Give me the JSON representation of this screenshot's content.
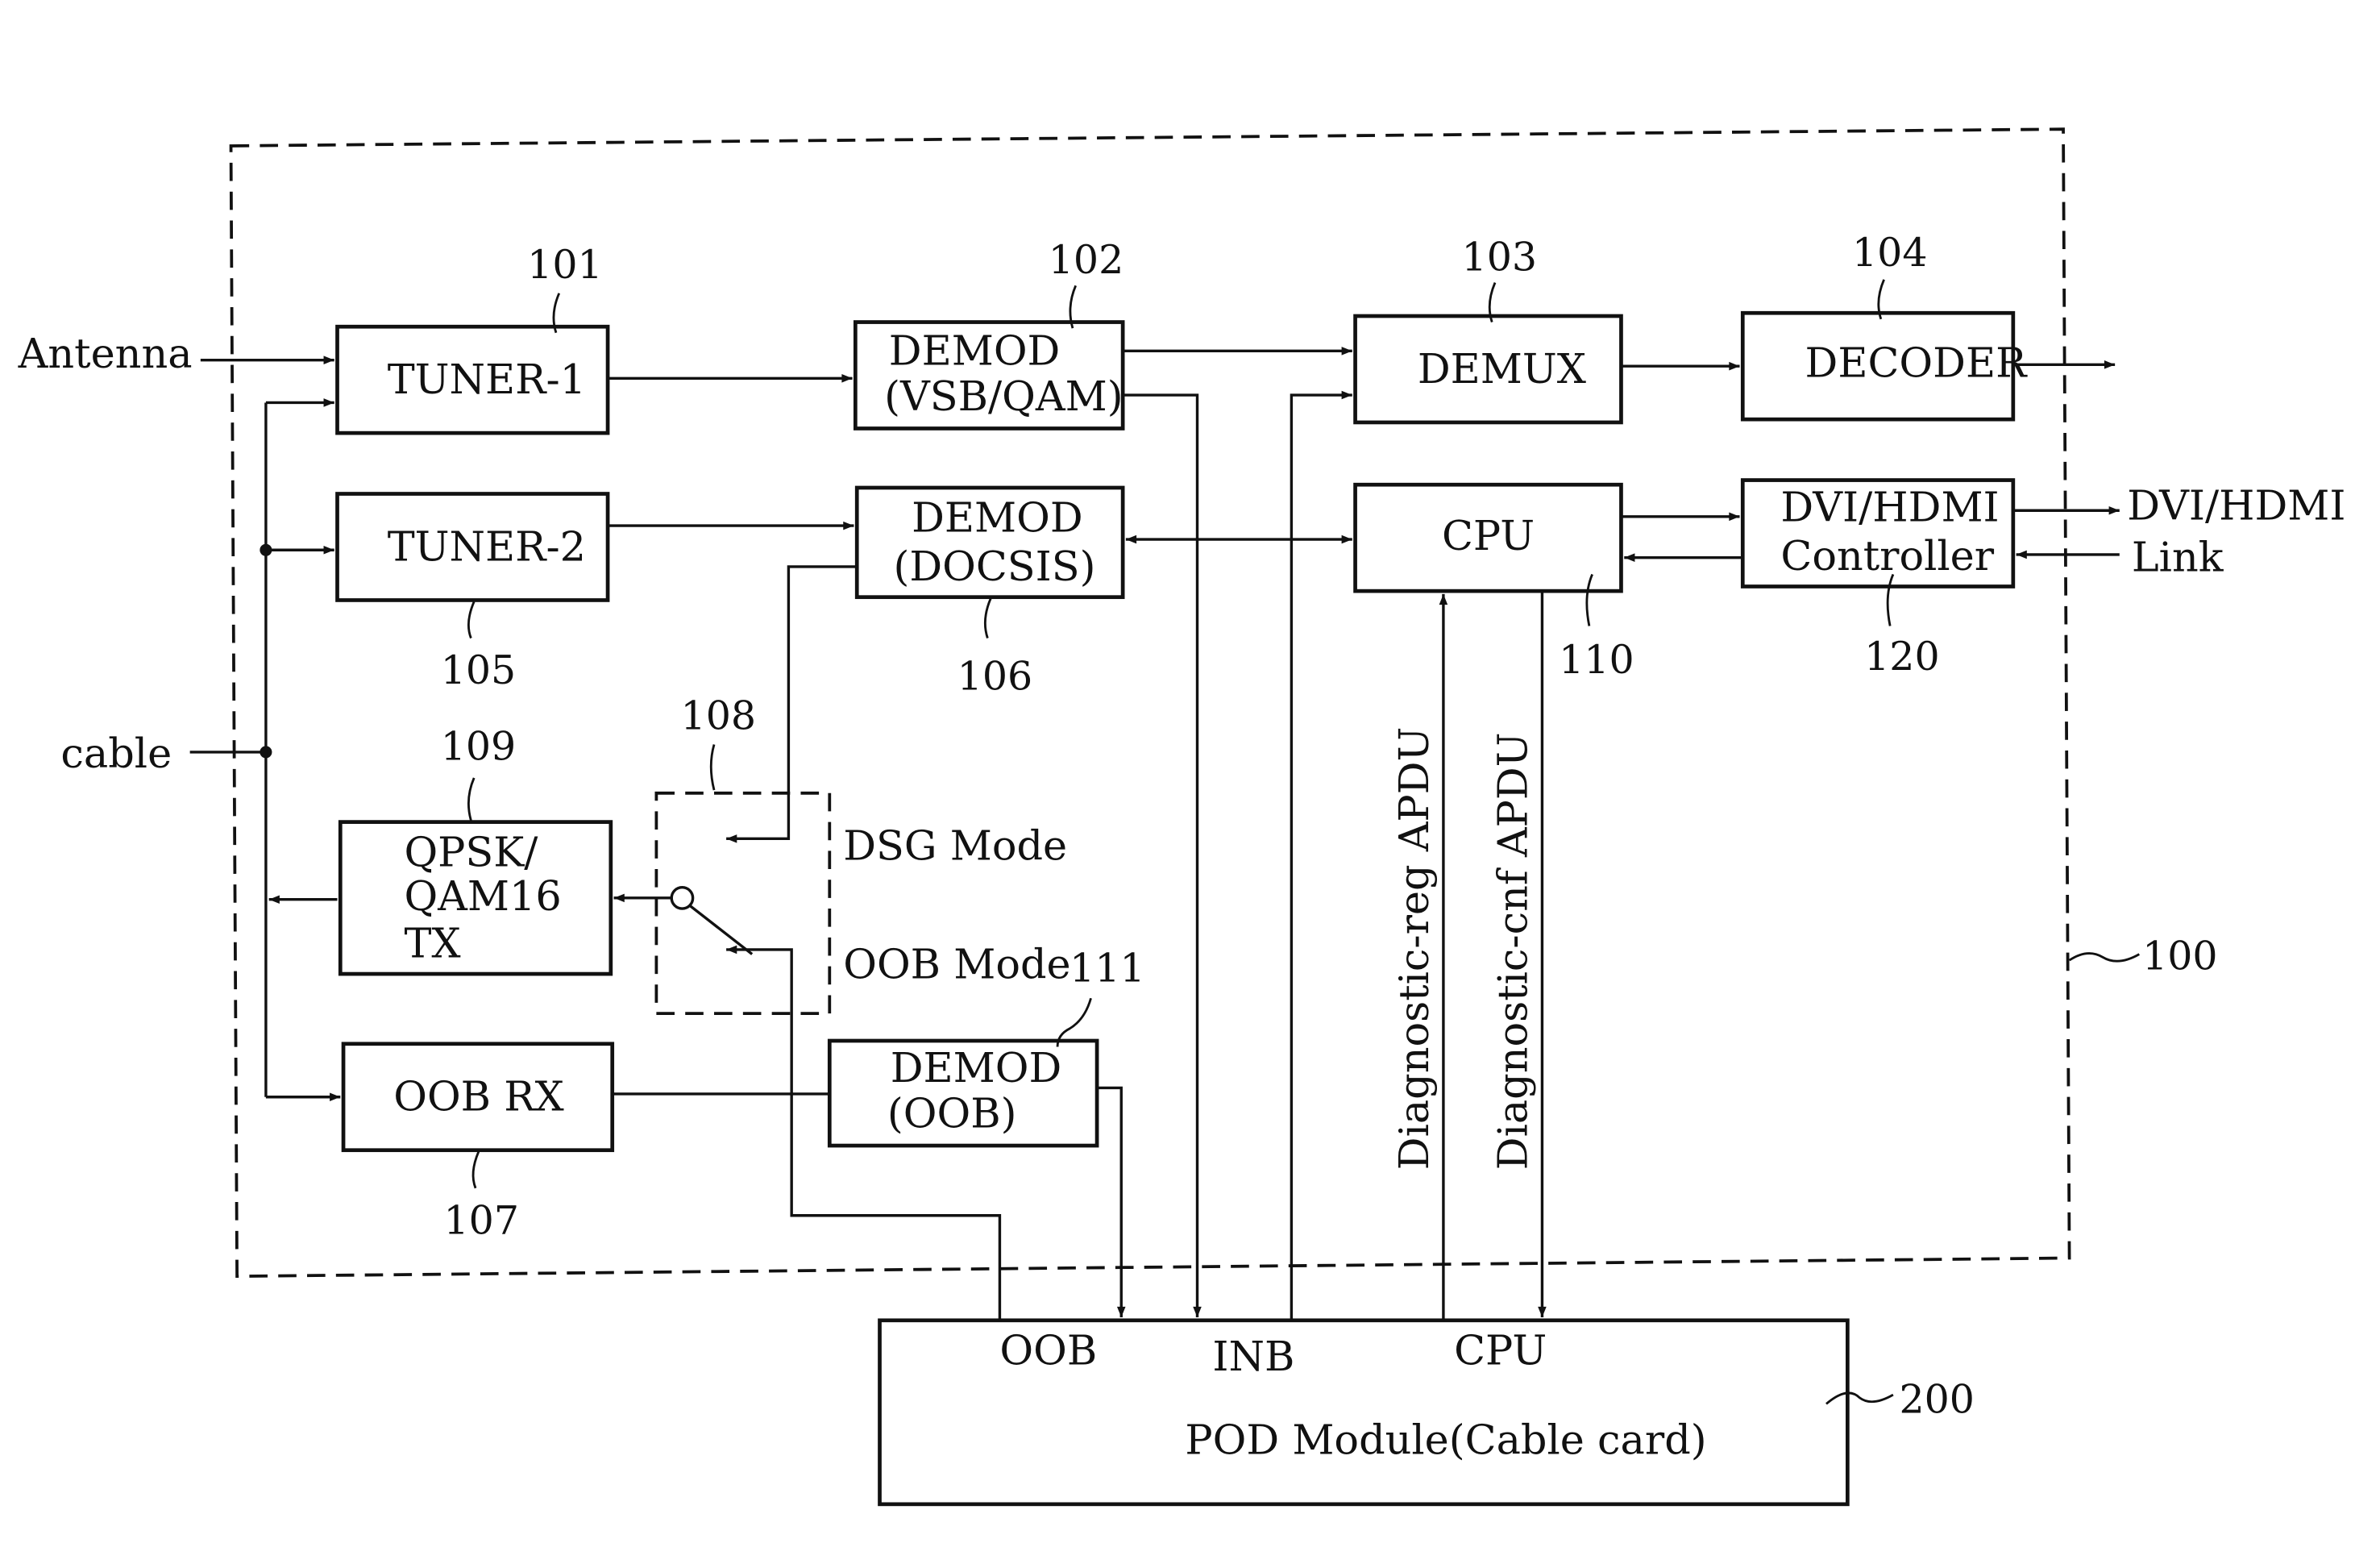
{
  "diagram": {
    "enclosure_ref": "100",
    "pod_ref": "200",
    "external_labels": {
      "antenna": "Antenna",
      "cable": "cable",
      "dvi_hdmi_out": "DVI/HDMI",
      "link": "Link"
    },
    "blocks": {
      "tuner1": {
        "lines": [
          "TUNER-1"
        ],
        "ref": "101"
      },
      "demod_vsb": {
        "lines": [
          "DEMOD",
          "(VSB/QAM)"
        ],
        "ref": "102"
      },
      "demux": {
        "lines": [
          "DEMUX"
        ],
        "ref": "103"
      },
      "decoder": {
        "lines": [
          "DECODER"
        ],
        "ref": "104"
      },
      "tuner2": {
        "lines": [
          "TUNER-2"
        ],
        "ref": "105"
      },
      "demod_docsis": {
        "lines": [
          "DEMOD",
          "(DOCSIS)"
        ],
        "ref": "106"
      },
      "cpu": {
        "lines": [
          "CPU"
        ],
        "ref": "110"
      },
      "dvi_ctrl": {
        "lines": [
          "DVI/HDMI",
          "Controller"
        ],
        "ref": "120"
      },
      "qpsk_tx": {
        "lines": [
          "QPSK/",
          "QAM16",
          "TX"
        ],
        "ref": "109"
      },
      "oob_rx": {
        "lines": [
          "OOB RX"
        ],
        "ref": "107"
      },
      "demod_oob": {
        "lines": [
          "DEMOD",
          "(OOB)"
        ],
        "ref": "111"
      },
      "switch": {
        "ref": "108",
        "dsg_mode": "DSG Mode",
        "oob_mode": "OOB Mode"
      }
    },
    "signals": {
      "diag_req": "Diagnostic-reg APDU",
      "diag_cnf": "Diagnostic-cnf APDU"
    },
    "pod": {
      "title": "POD Module(Cable card)",
      "ports": [
        "OOB",
        "INB",
        "CPU"
      ]
    }
  }
}
